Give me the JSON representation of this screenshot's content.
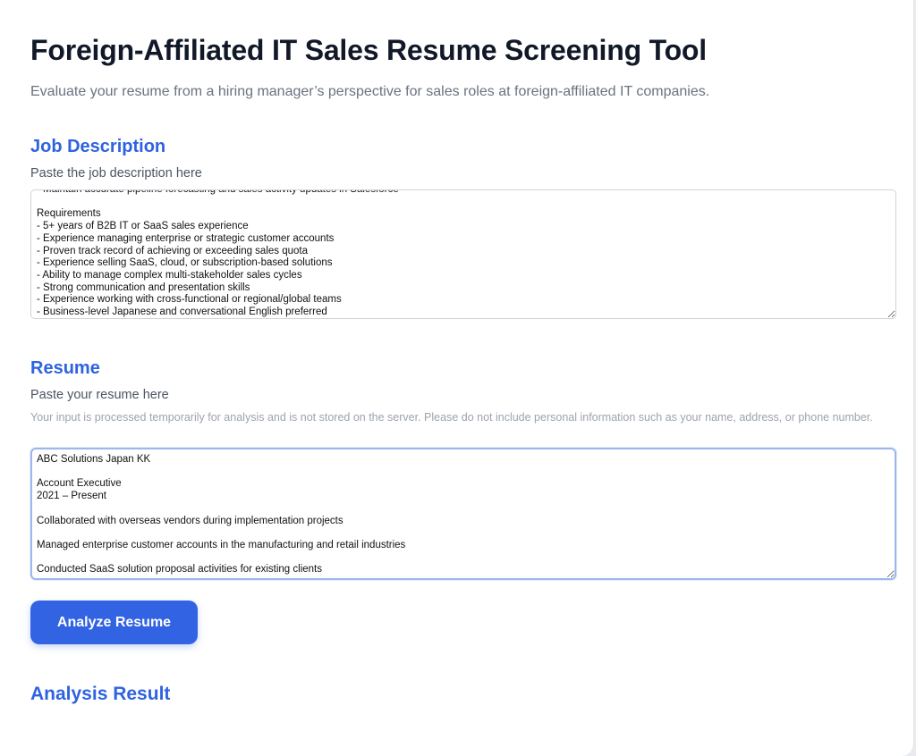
{
  "header": {
    "title": "Foreign-Affiliated IT Sales Resume Screening Tool",
    "subtitle": "Evaluate your resume from a hiring manager’s perspective for sales roles at foreign-affiliated IT companies."
  },
  "job_description": {
    "heading": "Job Description",
    "label": "Paste the job description here",
    "value": "- Maintain accurate pipeline forecasting and sales activity updates in Salesforce\n\nRequirements\n- 5+ years of B2B IT or SaaS sales experience\n- Experience managing enterprise or strategic customer accounts\n- Proven track record of achieving or exceeding sales quota\n- Experience selling SaaS, cloud, or subscription-based solutions\n- Ability to manage complex multi-stakeholder sales cycles\n- Strong communication and presentation skills\n- Experience working with cross-functional or regional/global teams\n- Business-level Japanese and conversational English preferred"
  },
  "resume": {
    "heading": "Resume",
    "label": "Paste your resume here",
    "privacy_note": "Your input is processed temporarily for analysis and is not stored on the server. Please do not include personal information such as your name, address, or phone number.",
    "value": "ABC Solutions Japan KK\n\nAccount Executive\n2021 – Present\n\nCollaborated with overseas vendors during implementation projects\n\nManaged enterprise customer accounts in the manufacturing and retail industries\n\nConducted SaaS solution proposal activities for existing clients"
  },
  "actions": {
    "analyze_label": "Analyze Resume"
  },
  "result": {
    "heading": "Analysis Result"
  }
}
